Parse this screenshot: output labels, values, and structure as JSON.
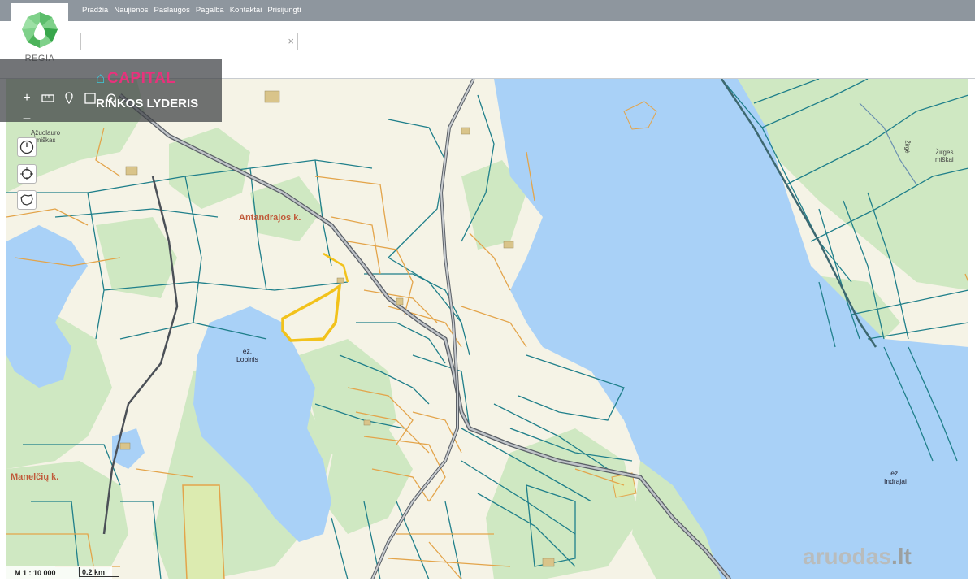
{
  "nav": {
    "items": [
      "Pradžia",
      "Naujienos",
      "Paslaugos",
      "Pagalba",
      "Kontaktai",
      "Prisijungti"
    ]
  },
  "logo": {
    "text": "REGIA"
  },
  "search": {
    "value": "",
    "clear_glyph": "×"
  },
  "advert": {
    "brand": "CAPITAL",
    "slogan": "RINKOS LYDERIS"
  },
  "map_controls": {
    "zoom_in": "+",
    "zoom_out": "−",
    "icons": [
      "measure-icon",
      "pin-icon",
      "layers-icon",
      "locate-icon",
      "history-icon",
      "crosshair-icon",
      "lithuania-icon"
    ]
  },
  "map_labels": {
    "antandrajos": "Antandrajos k.",
    "maneliciu": "Manelčių k.",
    "lobinis": [
      "ež.",
      "Lobinis"
    ],
    "indrajai": [
      "ež.",
      "Indrajai"
    ],
    "azuolaurio": [
      "Ąžuolauro",
      "miškas"
    ],
    "zirges": [
      "Žirgės",
      "miškai"
    ],
    "zirge_stream": "Žirgė"
  },
  "scale": {
    "ratio": "M 1 : 10 000",
    "bar_label": "0.2 km"
  },
  "watermark": {
    "text": "aruodas",
    "suffix": ".lt"
  },
  "colors": {
    "water": "#a9d1f7",
    "forest": "#cfe8c2",
    "open": "#f5f3e6",
    "parcel_teal": "#1f7f8a",
    "parcel_orange": "#e3a44a",
    "highlight": "#f2c21b",
    "road": "#555a61",
    "topbar": "#8e969e",
    "brand_pink": "#e8327c"
  }
}
